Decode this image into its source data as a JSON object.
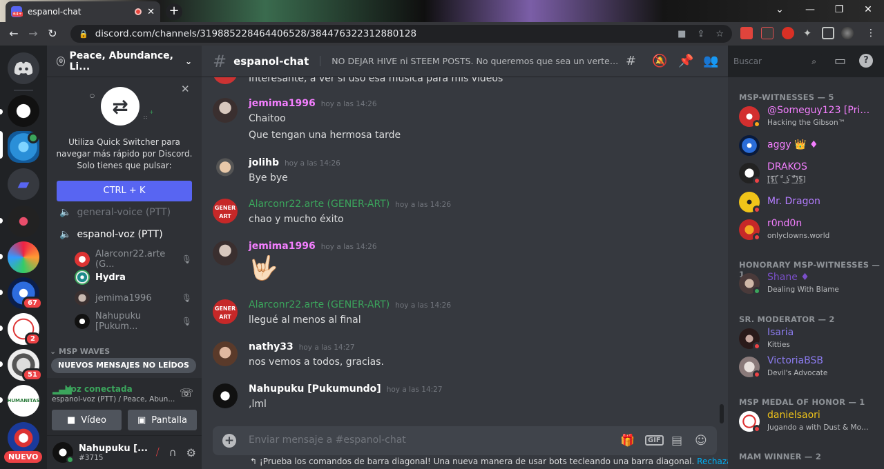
{
  "browser": {
    "tab_title": "espanol-chat",
    "url": "discord.com/channels/319885228464406528/384476322312880128"
  },
  "guilds": {
    "badges": [
      "67",
      "2",
      "51"
    ],
    "new_label": "NUEVO"
  },
  "sidebar": {
    "server_name": "Peace, Abundance, Li...",
    "quick_switcher": {
      "text": "Utiliza Quick Switcher para navegar más rápido por Discord. Solo tienes que pulsar:",
      "button": "CTRL + K"
    },
    "channels": {
      "general_voice": "general-voice (PTT)",
      "espanol_voz": "espanol-voz (PTT)",
      "category": "MSP WAVES"
    },
    "voice_users": [
      {
        "name": "Alarconr22.arte (G...",
        "color": "#8e9297"
      },
      {
        "name": "Hydra",
        "color": "#ffffff"
      },
      {
        "name": "jemima1996",
        "color": "#8e9297"
      },
      {
        "name": "Nahupuku [Pukum...",
        "color": "#8e9297"
      }
    ],
    "new_messages": "NUEVOS MENSAJES NO LEÍDOS",
    "voice_status": "Voz conectada",
    "voice_location": "espanol-voz (PTT) / Peace, Abun...",
    "video_button": "Vídeo",
    "screen_button": "Pantalla",
    "user_name": "Nahupuku [...",
    "user_tag": "#3715"
  },
  "chat": {
    "channel_name": "espanol-chat",
    "topic": "NO DEJAR HIVE ni STEEM POSTS. No queremos que sea un vertedero de pub...",
    "search_placeholder": "Buscar",
    "partial_line": "Interesante, a ver si uso esa musica para mis videos",
    "messages": [
      {
        "author": "jemima1996",
        "time": "hoy a las 14:26",
        "color": "#f47fff",
        "lines": [
          "Chaitoo",
          "Que tengan una hermosa tarde"
        ]
      },
      {
        "author": "jolihb",
        "time": "hoy a las 14:26",
        "color": "#ffffff",
        "lines": [
          "Bye bye"
        ]
      },
      {
        "author": "Alarconr22.arte (GENER-ART)",
        "time": "hoy a las 14:26",
        "color": "#3ba55c",
        "lines": [
          "chao y mucho éxito"
        ]
      },
      {
        "author": "jemima1996",
        "time": "hoy a las 14:26",
        "color": "#f47fff",
        "lines": [
          "🤟🏻"
        ]
      },
      {
        "author": "Alarconr22.arte (GENER-ART)",
        "time": "hoy a las 14:26",
        "color": "#3ba55c",
        "lines": [
          "llegué al menos al final"
        ]
      },
      {
        "author": "nathy33",
        "time": "hoy a las 14:27",
        "color": "#ffffff",
        "lines": [
          "nos vemos a todos, gracias."
        ]
      },
      {
        "author": "Nahupuku [Pukumundo]",
        "time": "hoy a las 14:27",
        "color": "#ffffff",
        "lines": [
          ",lml"
        ]
      }
    ],
    "composer_placeholder": "Enviar mensaje a #espanol-chat",
    "tip_text": "¡Prueba los comandos de barra diagonal! Una nueva manera de usar bots tecleando una barra diagonal.",
    "tip_link": "Rechazar"
  },
  "members": {
    "categories": [
      {
        "label": "MSP-WITNESSES — 5"
      },
      {
        "label": "HONORARY MSP-WITNESSES — 1"
      },
      {
        "label": "SR. MODERATOR — 2"
      },
      {
        "label": "MSP MEDAL OF HONOR — 1"
      },
      {
        "label": "MAM WINNER — 2"
      }
    ],
    "list": [
      {
        "name": "@Someguy123 [Privex...",
        "activity": "Hacking the Gibson™",
        "color": "#f47fff"
      },
      {
        "name": "aggy 👑 ♦",
        "activity": "",
        "color": "#f47fff"
      },
      {
        "name": "DRAKOS",
        "activity": "[̲̅$̲̅(̲̅ ͡° ͜ʖ ͡°̲̅)̲̅$̲̅]",
        "color": "#f47fff"
      },
      {
        "name": "Mr. Dragon",
        "activity": "",
        "color": "#b47dff"
      },
      {
        "name": "r0nd0n",
        "activity": "onlyclowns.world",
        "color": "#f47fff"
      },
      {
        "name": "Shane ♦",
        "activity": "Dealing With Blame",
        "color": "#7a4fc9"
      },
      {
        "name": "Isaria",
        "activity": "Kitties",
        "color": "#8c7cf0"
      },
      {
        "name": "VictoriaBSB",
        "activity": "Devil's Advocate",
        "color": "#8c7cf0"
      },
      {
        "name": "danielsaori",
        "activity": "Jugando a with Dust & Monste...",
        "color": "#f0c419"
      }
    ]
  }
}
